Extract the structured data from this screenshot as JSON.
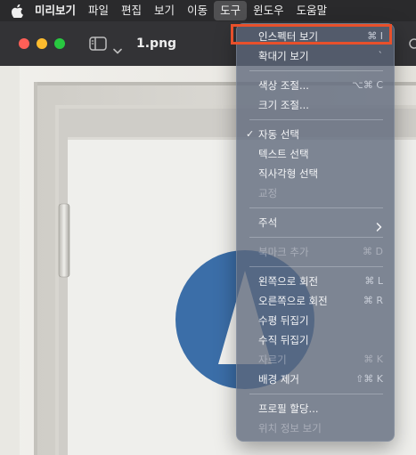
{
  "menubar": {
    "apple_icon": "apple-logo-icon",
    "items": [
      {
        "label": "미리보기",
        "bold": true
      },
      {
        "label": "파일"
      },
      {
        "label": "편집"
      },
      {
        "label": "보기"
      },
      {
        "label": "이동"
      },
      {
        "label": "도구",
        "active": true
      },
      {
        "label": "윈도우"
      },
      {
        "label": "도움말"
      }
    ]
  },
  "window": {
    "title": "1.png",
    "icons": [
      "sidebar-toggle-icon",
      "chevron-down-icon"
    ]
  },
  "tools_menu": {
    "items": [
      {
        "label": "인스펙터 보기",
        "shortcut": "⌘ I",
        "highlighted": true
      },
      {
        "label": "확대기 보기",
        "shortcut": "`"
      },
      {
        "label": "색상 조절...",
        "shortcut": "⌥⌘ C"
      },
      {
        "label": "크기 조절..."
      },
      {
        "label": "자동 선택",
        "checked": true
      },
      {
        "label": "텍스트 선택"
      },
      {
        "label": "직사각형 선택"
      },
      {
        "label": "교정",
        "disabled": true
      },
      {
        "label": "주석",
        "submenu": true
      },
      {
        "label": "북마크 추가",
        "shortcut": "⌘ D",
        "disabled": true
      },
      {
        "label": "왼쪽으로 회전",
        "shortcut": "⌘ L"
      },
      {
        "label": "오른쪽으로 회전",
        "shortcut": "⌘ R"
      },
      {
        "label": "수평 뒤집기"
      },
      {
        "label": "수직 뒤집기"
      },
      {
        "label": "자르기",
        "shortcut": "⌘ K",
        "disabled": true
      },
      {
        "label": "배경 제거",
        "shortcut": "⇧⌘ K"
      },
      {
        "label": "프로필 할당..."
      },
      {
        "label": "위치 정보 보기",
        "disabled": true
      }
    ],
    "check_mark": "✓"
  },
  "colors": {
    "highlight_outline": "#e8502b",
    "menubar_bg": "#2a2a2c",
    "menu_bg": "#5c677a",
    "sign_blue": "#3b6ea8"
  }
}
